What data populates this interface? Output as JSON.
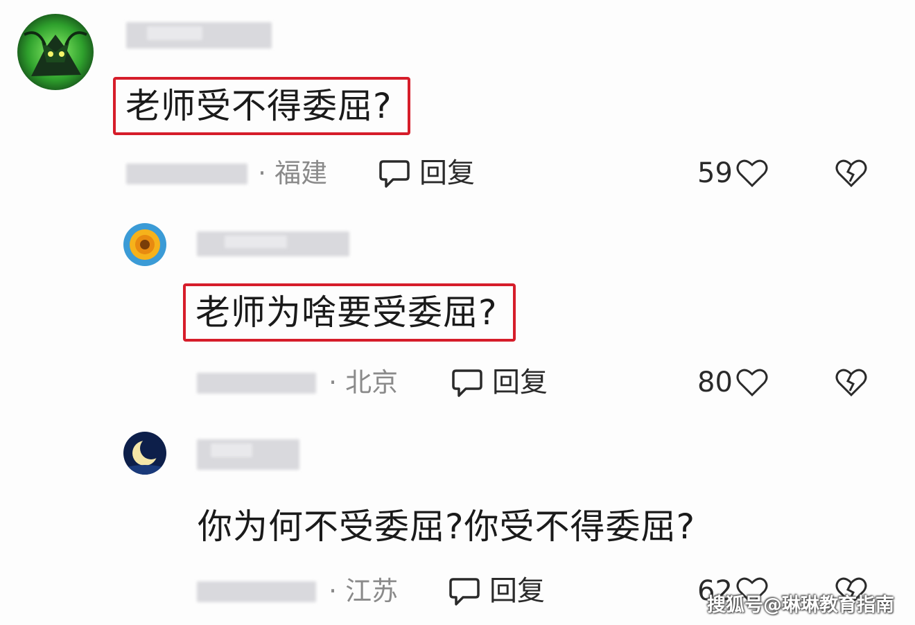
{
  "comments": [
    {
      "text": "老师受不得委屈?",
      "location": "· 福建",
      "reply_label": "回复",
      "likes": "59",
      "highlighted": true,
      "avatar": "green-character-avatar"
    },
    {
      "text": "老师为啥要受委屈?",
      "location": "· 北京",
      "reply_label": "回复",
      "likes": "80",
      "highlighted": true,
      "avatar": "orange-flower-avatar"
    },
    {
      "text": "你为何不受委屈?你受不得委屈?",
      "location": "· 江苏",
      "reply_label": "回复",
      "likes": "62",
      "highlighted": false,
      "avatar": "crescent-moon-avatar"
    }
  ],
  "watermark": "搜狐号@琳琳教育指南",
  "colors": {
    "highlight_border": "#d61d2a",
    "background": "#fdfdfd",
    "meta_text": "#8a8a8a"
  }
}
